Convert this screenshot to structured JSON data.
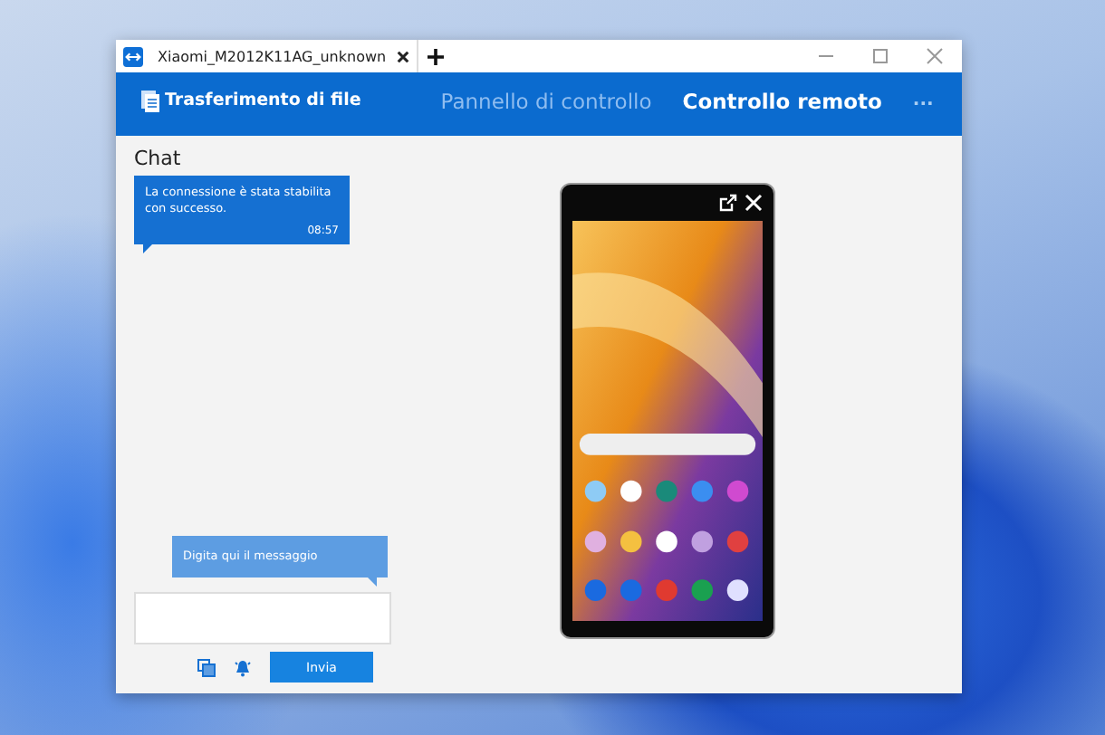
{
  "window": {
    "tab_title": "Xiaomi_M2012K11AG_unknown"
  },
  "header": {
    "file_transfer": "Trasferimento di file",
    "tabs": [
      {
        "label": "Pannello di controllo",
        "selected": false
      },
      {
        "label": "Controllo remoto",
        "selected": true
      }
    ],
    "more": "..."
  },
  "chat": {
    "title": "Chat",
    "messages": [
      {
        "text": "La connessione è stata stabilita con successo.",
        "time": "08:57"
      }
    ],
    "input_hint": "Digita qui il messaggio",
    "send": "Invia"
  }
}
